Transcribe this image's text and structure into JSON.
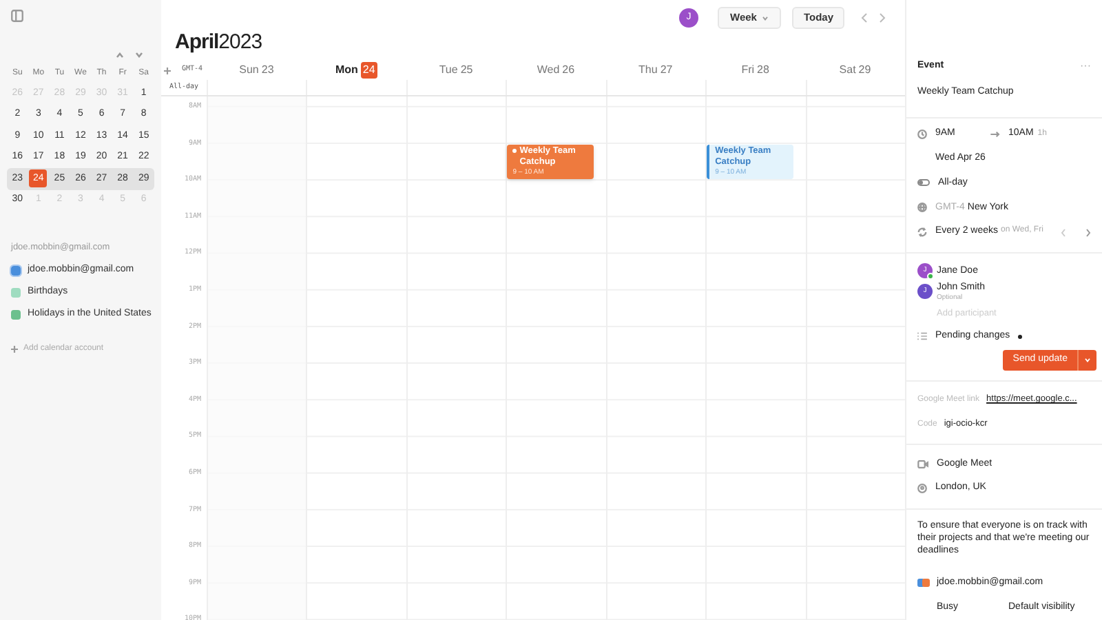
{
  "sidebar": {
    "mini_calendar": {
      "weekdays": [
        "Su",
        "Mo",
        "Tu",
        "We",
        "Th",
        "Fr",
        "Sa"
      ],
      "weeks": [
        {
          "selected": false,
          "days": [
            {
              "label": "26",
              "muted": true,
              "today": false
            },
            {
              "label": "27",
              "muted": true,
              "today": false
            },
            {
              "label": "28",
              "muted": true,
              "today": false
            },
            {
              "label": "29",
              "muted": true,
              "today": false
            },
            {
              "label": "30",
              "muted": true,
              "today": false
            },
            {
              "label": "31",
              "muted": true,
              "today": false
            },
            {
              "label": "1",
              "muted": false,
              "today": false
            }
          ]
        },
        {
          "selected": false,
          "days": [
            {
              "label": "2",
              "muted": false,
              "today": false
            },
            {
              "label": "3",
              "muted": false,
              "today": false
            },
            {
              "label": "4",
              "muted": false,
              "today": false
            },
            {
              "label": "5",
              "muted": false,
              "today": false
            },
            {
              "label": "6",
              "muted": false,
              "today": false
            },
            {
              "label": "7",
              "muted": false,
              "today": false
            },
            {
              "label": "8",
              "muted": false,
              "today": false
            }
          ]
        },
        {
          "selected": false,
          "days": [
            {
              "label": "9",
              "muted": false,
              "today": false
            },
            {
              "label": "10",
              "muted": false,
              "today": false
            },
            {
              "label": "11",
              "muted": false,
              "today": false
            },
            {
              "label": "12",
              "muted": false,
              "today": false
            },
            {
              "label": "13",
              "muted": false,
              "today": false
            },
            {
              "label": "14",
              "muted": false,
              "today": false
            },
            {
              "label": "15",
              "muted": false,
              "today": false
            }
          ]
        },
        {
          "selected": false,
          "days": [
            {
              "label": "16",
              "muted": false,
              "today": false
            },
            {
              "label": "17",
              "muted": false,
              "today": false
            },
            {
              "label": "18",
              "muted": false,
              "today": false
            },
            {
              "label": "19",
              "muted": false,
              "today": false
            },
            {
              "label": "20",
              "muted": false,
              "today": false
            },
            {
              "label": "21",
              "muted": false,
              "today": false
            },
            {
              "label": "22",
              "muted": false,
              "today": false
            }
          ]
        },
        {
          "selected": true,
          "days": [
            {
              "label": "23",
              "muted": false,
              "today": false
            },
            {
              "label": "24",
              "muted": false,
              "today": true
            },
            {
              "label": "25",
              "muted": false,
              "today": false
            },
            {
              "label": "26",
              "muted": false,
              "today": false
            },
            {
              "label": "27",
              "muted": false,
              "today": false
            },
            {
              "label": "28",
              "muted": false,
              "today": false
            },
            {
              "label": "29",
              "muted": false,
              "today": false
            }
          ]
        },
        {
          "selected": false,
          "days": [
            {
              "label": "30",
              "muted": false,
              "today": false
            },
            {
              "label": "1",
              "muted": true,
              "today": false
            },
            {
              "label": "2",
              "muted": true,
              "today": false
            },
            {
              "label": "3",
              "muted": true,
              "today": false
            },
            {
              "label": "4",
              "muted": true,
              "today": false
            },
            {
              "label": "5",
              "muted": true,
              "today": false
            },
            {
              "label": "6",
              "muted": true,
              "today": false
            }
          ]
        }
      ]
    },
    "account": "jdoe.mobbin@gmail.com",
    "calendars": [
      {
        "label": "jdoe.mobbin@gmail.com",
        "color": "#4a8fdc",
        "checked": true
      },
      {
        "label": "Birthdays",
        "color": "#9fdcc0",
        "checked": false
      },
      {
        "label": "Holidays in the United States",
        "color": "#6cc08e",
        "checked": false
      }
    ],
    "add_account": "Add calendar account"
  },
  "header": {
    "avatar": "J",
    "view": "Week",
    "today_button": "Today",
    "title_month": "April",
    "title_year": "2023"
  },
  "week": {
    "timezone": "GMT-4",
    "all_day": "All-day",
    "days": [
      {
        "name": "Sun",
        "date": "23",
        "today": false
      },
      {
        "name": "Mon",
        "date": "24",
        "today": true
      },
      {
        "name": "Tue",
        "date": "25",
        "today": false
      },
      {
        "name": "Wed",
        "date": "26",
        "today": false,
        "events": [
          {
            "title": "Weekly Team Catchup",
            "time": "9 – 10 AM",
            "selected": true
          }
        ]
      },
      {
        "name": "Thu",
        "date": "27",
        "today": false
      },
      {
        "name": "Fri",
        "date": "28",
        "today": false,
        "events": [
          {
            "title": "Weekly Team Catchup",
            "time": "9 – 10 AM",
            "selected": false
          }
        ]
      },
      {
        "name": "Sat",
        "date": "29",
        "today": false
      }
    ],
    "hours": [
      "8AM",
      "9AM",
      "10AM",
      "11AM",
      "12PM",
      "1PM",
      "2PM",
      "3PM",
      "4PM",
      "5PM",
      "6PM",
      "7PM",
      "8PM",
      "9PM",
      "10PM"
    ]
  },
  "event_panel": {
    "heading": "Event",
    "more": "···",
    "title": "Weekly Team Catchup",
    "start": "9AM",
    "end": "10AM",
    "duration": "1h",
    "date": "Wed Apr 26",
    "all_day": {
      "label": "All-day",
      "on": false
    },
    "timezone_offset": "GMT-4",
    "timezone_city": "New York",
    "repeat": "Every 2 weeks",
    "repeat_days": "on Wed, Fri",
    "participants": [
      {
        "name": "Jane Doe",
        "initial": "J",
        "color": "#9b4fc9",
        "accepted": true
      },
      {
        "name": "John Smith",
        "note": "Optional",
        "initial": "J",
        "color": "#6b4fc9",
        "accepted": false
      }
    ],
    "add_participant": "Add participant",
    "pending": "Pending changes",
    "send_button": "Send update",
    "meet_link_label": "Google Meet link",
    "meet_link": "https://meet.google.c...",
    "code_label": "Code",
    "code": "igi-ocio-kcr",
    "conference": "Google Meet",
    "location": "London, UK",
    "description": "To ensure that everyone is on track with their projects and that we're meeting our deadlines",
    "calendar": "jdoe.mobbin@gmail.com",
    "busy": "Busy",
    "visibility": "Default visibility"
  }
}
